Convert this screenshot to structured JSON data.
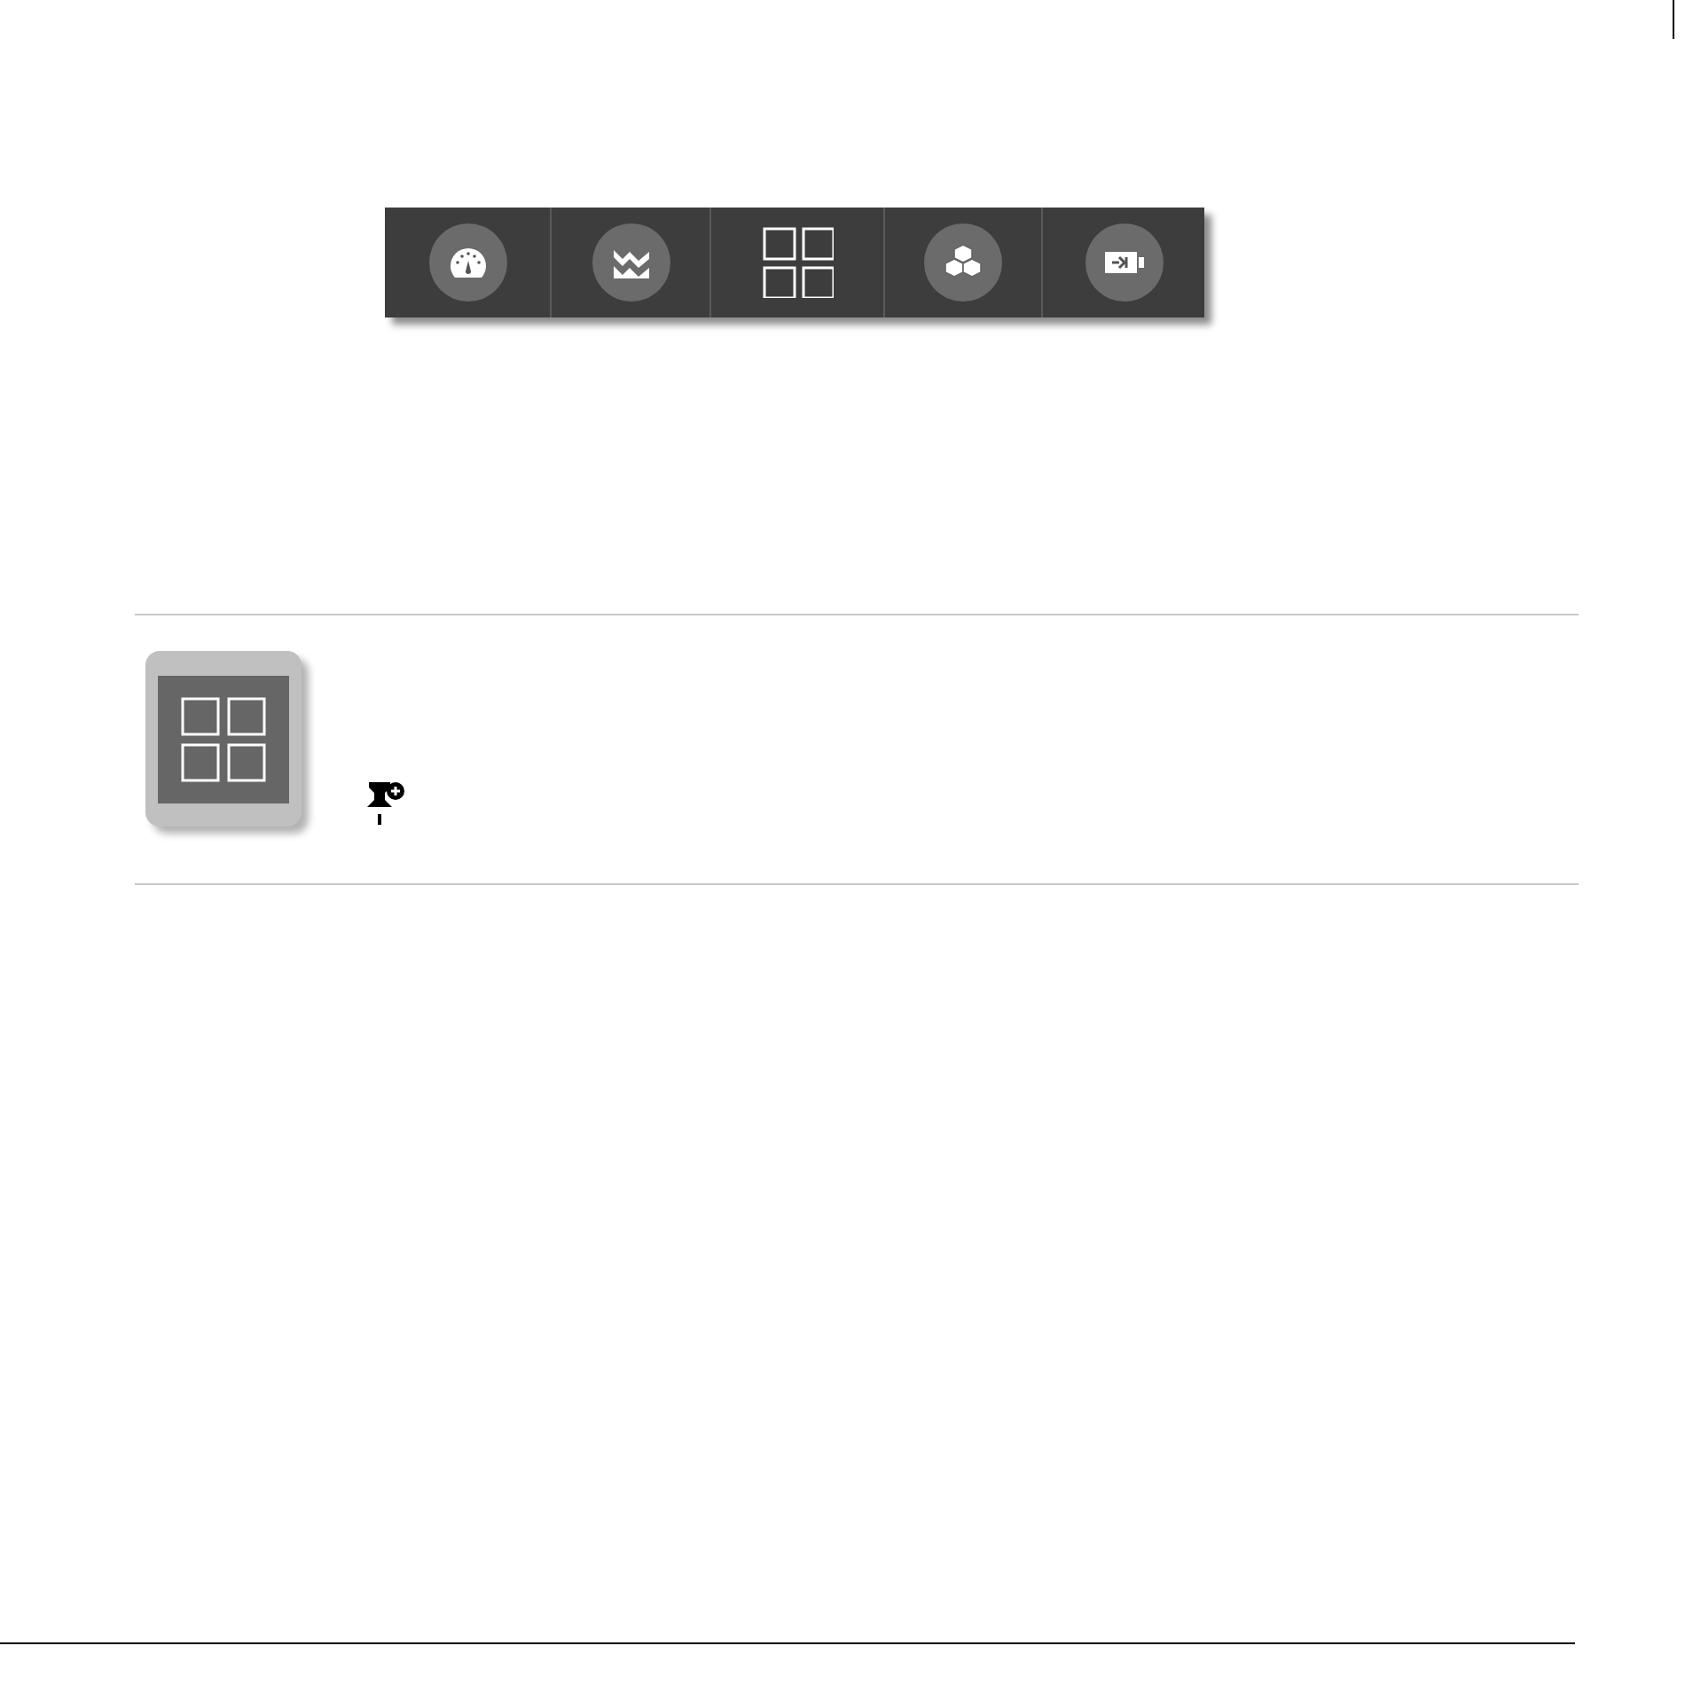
{
  "toolbar": {
    "items": [
      {
        "kind": "gauge"
      },
      {
        "kind": "chart"
      },
      {
        "kind": "grid"
      },
      {
        "kind": "cubes"
      },
      {
        "kind": "battery"
      }
    ]
  },
  "tile": {
    "kind": "grid"
  }
}
